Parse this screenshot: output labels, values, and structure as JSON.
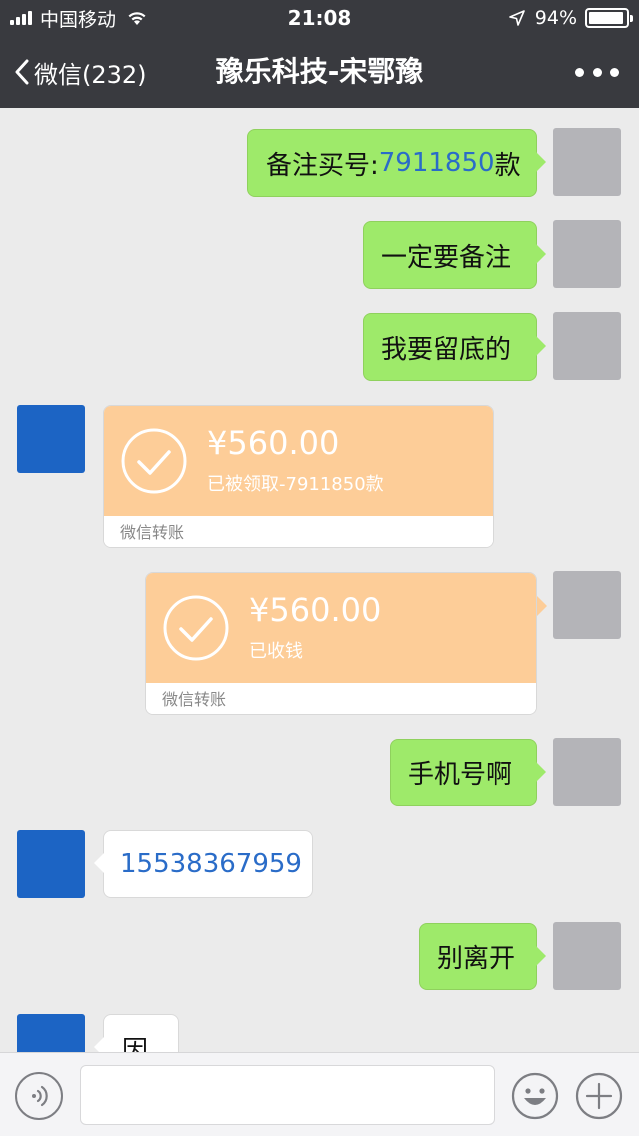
{
  "status_bar": {
    "carrier": "中国移动",
    "time": "21:08",
    "battery": "94%",
    "battery_level": 0.94
  },
  "nav": {
    "back_label": "微信(232)",
    "title": "豫乐科技-宋鄂豫",
    "more_icon": "more-icon"
  },
  "messages": [
    {
      "side": "right",
      "type": "text",
      "prefix": "备注买号:",
      "highlight": "7911850",
      "suffix": "款"
    },
    {
      "side": "right",
      "type": "text",
      "text": "一定要备注"
    },
    {
      "side": "right",
      "type": "text",
      "text": "我要留底的"
    },
    {
      "side": "left",
      "type": "transfer",
      "amount": "¥560.00",
      "status": "已被领取-7911850款",
      "footer": "微信转账"
    },
    {
      "side": "right",
      "type": "transfer",
      "amount": "¥560.00",
      "status": "已收钱",
      "footer": "微信转账"
    },
    {
      "side": "right",
      "type": "text",
      "text": "手机号啊"
    },
    {
      "side": "left",
      "type": "text",
      "text": "15538367959"
    },
    {
      "side": "right",
      "type": "text",
      "text": "别离开"
    },
    {
      "side": "left",
      "type": "text",
      "text": "因"
    }
  ],
  "input_bar": {
    "voice_icon": "voice-icon",
    "emoji_icon": "emoji-icon",
    "plus_icon": "plus-icon"
  },
  "colors": {
    "bar": "#393a3f",
    "chat_bg": "#ebebeb",
    "green_bubble": "#9eea6a",
    "transfer": "#fdcd98",
    "link": "#2a6cc8"
  }
}
